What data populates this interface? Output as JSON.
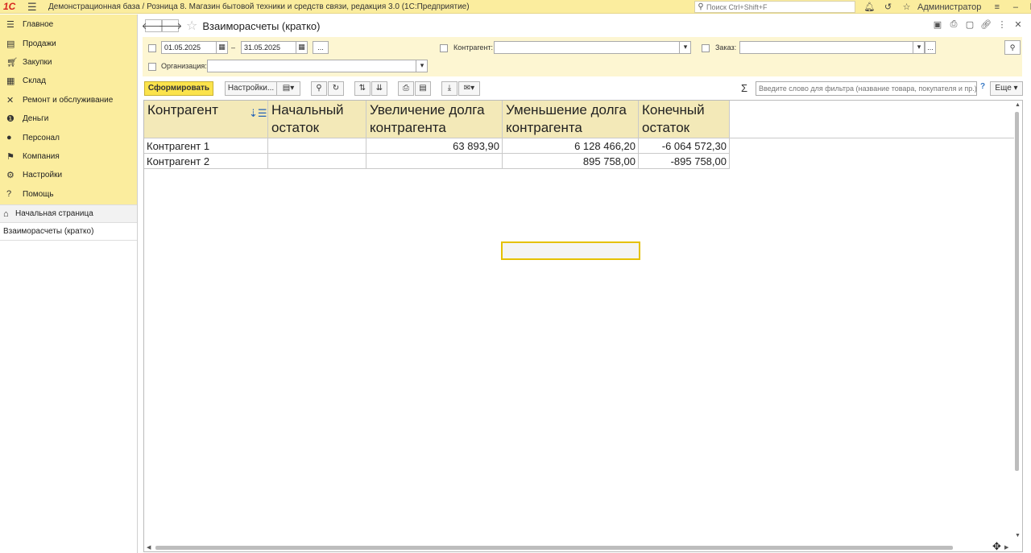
{
  "app": {
    "logo": "1С",
    "title": "Демонстрационная база / Розница 8. Магазин бытовой техники и средств связи, редакция 3.0  (1С:Предприятие)",
    "search_placeholder": "Поиск Ctrl+Shift+F",
    "user": "Администратор"
  },
  "sidebar": {
    "items": [
      {
        "label": "Главное",
        "icon": "menu-icon"
      },
      {
        "label": "Продажи",
        "icon": "cash-register-icon"
      },
      {
        "label": "Закупки",
        "icon": "cart-icon"
      },
      {
        "label": "Склад",
        "icon": "warehouse-icon"
      },
      {
        "label": "Ремонт и обслуживание",
        "icon": "tools-icon"
      },
      {
        "label": "Деньги",
        "icon": "money-icon"
      },
      {
        "label": "Персонал",
        "icon": "person-icon"
      },
      {
        "label": "Компания",
        "icon": "flag-icon"
      },
      {
        "label": "Настройки",
        "icon": "gear-icon"
      },
      {
        "label": "Помощь",
        "icon": "help-icon"
      }
    ],
    "nav": [
      {
        "label": "Начальная страница"
      },
      {
        "label": "Взаиморасчеты (кратко)"
      }
    ]
  },
  "page": {
    "title": "Взаиморасчеты (кратко)"
  },
  "filters": {
    "date_from": "01.05.2025",
    "date_to": "31.05.2025",
    "dash": "–",
    "ellipsis": "...",
    "kontragent_label": "Контрагент:",
    "zakaz_label": "Заказ:",
    "organizaciya_label": "Организация:"
  },
  "toolbar": {
    "generate": "Сформировать",
    "settings": "Настройки...",
    "filter_placeholder": "Введите слово для фильтра (название товара, покупателя и пр.)",
    "help": "?",
    "more": "Еще"
  },
  "table": {
    "headers": [
      "Контрагент",
      "Начальный остаток",
      "Увеличение долга контрагента",
      "Уменьшение долга контрагента",
      "Конечный остаток"
    ],
    "rows": [
      [
        "Контрагент 1",
        "",
        "63 893,90",
        "6 128 466,20",
        "-6 064 572,30"
      ],
      [
        "Контрагент 2",
        "",
        "",
        "895 758,00",
        "-895 758,00"
      ]
    ]
  }
}
